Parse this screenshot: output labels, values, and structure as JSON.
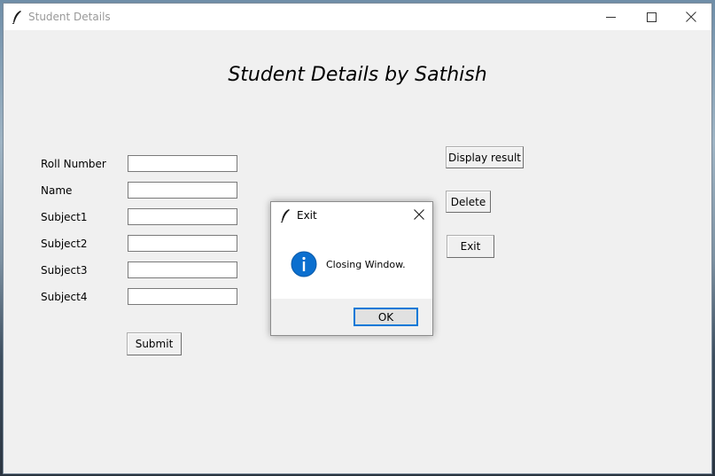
{
  "window": {
    "title": "Student Details",
    "heading": "Student Details by Sathish"
  },
  "form": {
    "fields": [
      {
        "label": "Roll Number",
        "value": ""
      },
      {
        "label": "Name",
        "value": ""
      },
      {
        "label": "Subject1",
        "value": ""
      },
      {
        "label": "Subject2",
        "value": ""
      },
      {
        "label": "Subject3",
        "value": ""
      },
      {
        "label": "Subject4",
        "value": ""
      }
    ],
    "submit_label": "Submit"
  },
  "actions": {
    "display_result_label": "Display result",
    "delete_label": "Delete",
    "exit_label": "Exit"
  },
  "dialog": {
    "title": "Exit",
    "message": "Closing Window.",
    "ok_label": "OK",
    "icon": "info-icon"
  },
  "colors": {
    "accent": "#0078d7",
    "info_icon": "#0b6fcf",
    "window_bg": "#f0f0f0"
  }
}
